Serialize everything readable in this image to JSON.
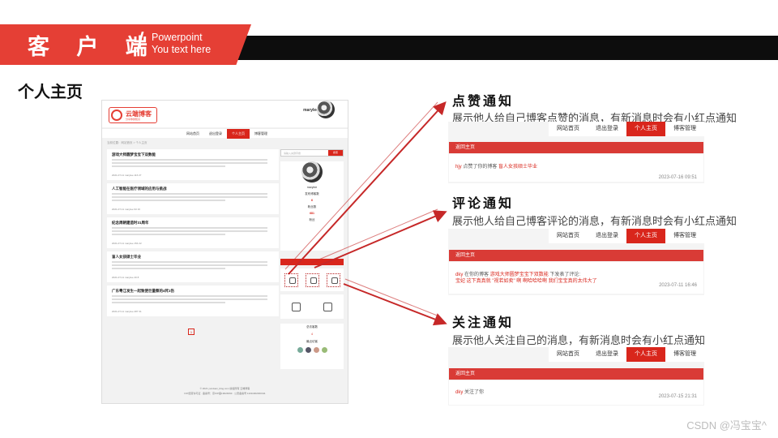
{
  "banner": {
    "title": "客 户 端",
    "slash": "/",
    "subtitle_line1": "Powerpoint",
    "subtitle_line2": "You text here"
  },
  "page_heading": "个人主页",
  "screenshot": {
    "logo_text": "云端博客",
    "logo_sub": "分享你的知识",
    "username": "marylee",
    "nav": [
      "网站首页",
      "退出登录",
      "个人主页",
      "博客管理"
    ],
    "nav_active_index": 2,
    "breadcrumb": "当前位置：网站首页 > 个人主页",
    "posts": [
      {
        "title": "游戏大师圆梦宝宝下双数能",
        "meta": "2021-07-11  marylee  116  27"
      },
      {
        "title": "人工智能在医疗领域的应用与挑战",
        "meta": "2021-07-11  marylee  93  16"
      },
      {
        "title": "纪念周朝建造时31周年",
        "meta": "2021-07-11  marylee  154  22"
      },
      {
        "title": "盲人女孩硕士毕业",
        "meta": "2021-07-11  marylee  40  8"
      },
      {
        "title": "广东粤江发生一起致使巨量蔡的4死1伤",
        "meta": "2021-07-11  marylee  287  31"
      }
    ],
    "page_number": "1",
    "search_placeholder": "请输入关键字搜",
    "search_button": "搜索",
    "profile_name": "marylee",
    "profile_lines": [
      "发布博客数",
      "6",
      "粉丝数",
      "681",
      "粉丝"
    ],
    "visit_lines": [
      "总访客数",
      "4",
      "最近访客"
    ],
    "footer_line1": "© 2021 yunduan_blog.com 版权所有  云端博客",
    "footer_line2": "ICP经营许可证 · 备案号：京ICP备19024693 · 公安备案号 11011902000411"
  },
  "sections": [
    {
      "title": "点赞通知",
      "desc": "展示他人给自己博客点赞的消息，有新消息时会有小红点通知",
      "nav": [
        "网站首页",
        "退出登录",
        "个人主页",
        "博客管理"
      ],
      "head": "返回主页",
      "line1_user": "hjy",
      "line1_text": " 点赞了你的博客 ",
      "line1_link": "盲人女孩硕士毕业",
      "line2": "",
      "date": "2023-07-16 09:51"
    },
    {
      "title": "评论通知",
      "desc": "展示他人给自己博客评论的消息，有新消息时会有小红点通知",
      "nav": [
        "网站首页",
        "退出登录",
        "个人主页",
        "博客管理"
      ],
      "head": "返回主页",
      "line1_user": "dky",
      "line1_text": " 在你的博客 ",
      "line1_link": "游戏大师圆梦宝宝下双数能",
      "line1_tail": " 下发表了评论:",
      "line2": "宝妃 这下真真就 \"视若如卖\" 啊 啊哈哈哈啊 我们宝宝真的太伟大了",
      "date": "2023-07-11 16:46"
    },
    {
      "title": "关注通知",
      "desc": "展示他人关注自己的消息，有新消息时会有小红点通知",
      "nav": [
        "网站首页",
        "退出登录",
        "个人主页",
        "博客管理"
      ],
      "head": "返回主页",
      "line1_user": "dky",
      "line1_text": " 关注了你",
      "line1_link": "",
      "line2": "",
      "date": "2023-07-15 21:31"
    }
  ],
  "watermark": "CSDN @冯宝宝^",
  "colors": {
    "accent": "#d9261c",
    "banner_red": "#e53f35",
    "banner_black": "#0d0d0d"
  }
}
